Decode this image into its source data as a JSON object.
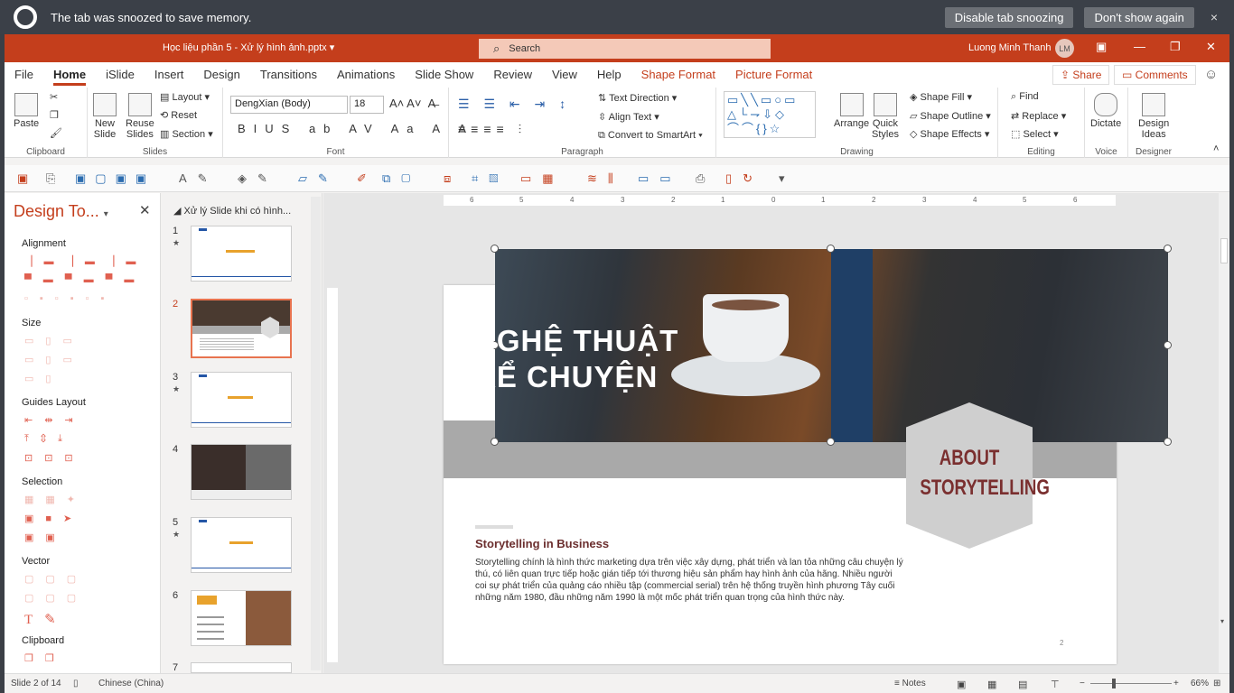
{
  "notification": {
    "message": "The tab was snoozed to save memory.",
    "disable_button": "Disable tab snoozing",
    "dont_show_button": "Don't show again",
    "close": "×"
  },
  "titlebar": {
    "document": "Học liệu phần 5 - Xử lý hình ảnh.pptx",
    "search_placeholder": "Search",
    "user": "Luong Minh Thanh",
    "initials": "LM"
  },
  "tabs": [
    "File",
    "Home",
    "iSlide",
    "Insert",
    "Design",
    "Transitions",
    "Animations",
    "Slide Show",
    "Review",
    "View",
    "Help",
    "Shape Format",
    "Picture Format"
  ],
  "share": "Share",
  "comments": "Comments",
  "ribbon": {
    "clipboard": {
      "label": "Clipboard",
      "paste": "Paste"
    },
    "slides": {
      "label": "Slides",
      "new_slide": "New\nSlide",
      "reuse": "Reuse\nSlides",
      "layout": "Layout",
      "reset": "Reset",
      "section": "Section"
    },
    "font": {
      "label": "Font",
      "name": "DengXian (Body)",
      "size": "18"
    },
    "paragraph": {
      "label": "Paragraph",
      "text_direction": "Text Direction",
      "align_text": "Align Text",
      "smartart": "Convert to SmartArt"
    },
    "drawing": {
      "label": "Drawing",
      "arrange": "Arrange",
      "quick_styles": "Quick\nStyles",
      "fill": "Shape Fill",
      "outline": "Shape Outline",
      "effects": "Shape Effects"
    },
    "editing": {
      "label": "Editing",
      "find": "Find",
      "replace": "Replace",
      "select": "Select"
    },
    "voice": {
      "label": "Voice",
      "dictate": "Dictate"
    },
    "designer": {
      "label": "Designer",
      "ideas": "Design\nIdeas"
    }
  },
  "design_pane": {
    "title": "Design To...",
    "sections": [
      "Alignment",
      "Size",
      "Guides Layout",
      "Selection",
      "Vector",
      "Clipboard"
    ]
  },
  "thumbnails": {
    "section_header": "Xử lý Slide khi có hình...",
    "numbers": [
      "1",
      "2",
      "3",
      "4",
      "5",
      "6",
      "7"
    ]
  },
  "slide": {
    "headline_line1": "NGHỆ THUẬT",
    "headline_line2": "KỂ CHUYỆN",
    "about_line1": "ABOUT",
    "about_line2": "STORYTELLING",
    "subheading": "Storytelling in Business",
    "body": "Storytelling chính là hình thức marketing dựa trên việc xây dựng, phát triển và lan tỏa những câu chuyện lý thú, có liên quan trực tiếp hoặc gián tiếp tới thương hiệu sản phẩm hay hình ảnh của hãng. Nhiều người coi sự phát triển của quảng cáo nhiều tập (commercial serial) trên hệ thống truyền hình phương Tây cuối những năm 1980, đầu những năm 1990 là một mốc phát triển quan trọng của hình thức này.",
    "page_number": "2"
  },
  "ruler_labels": [
    "6",
    "5",
    "4",
    "3",
    "2",
    "1",
    "0",
    "1",
    "2",
    "3",
    "4",
    "5",
    "6"
  ],
  "status": {
    "slide_of": "Slide 2 of 14",
    "language": "Chinese (China)",
    "notes": "Notes",
    "zoom": "66%"
  },
  "colors": {
    "accent": "#c43e1c",
    "about_text": "#7a2f2f"
  }
}
